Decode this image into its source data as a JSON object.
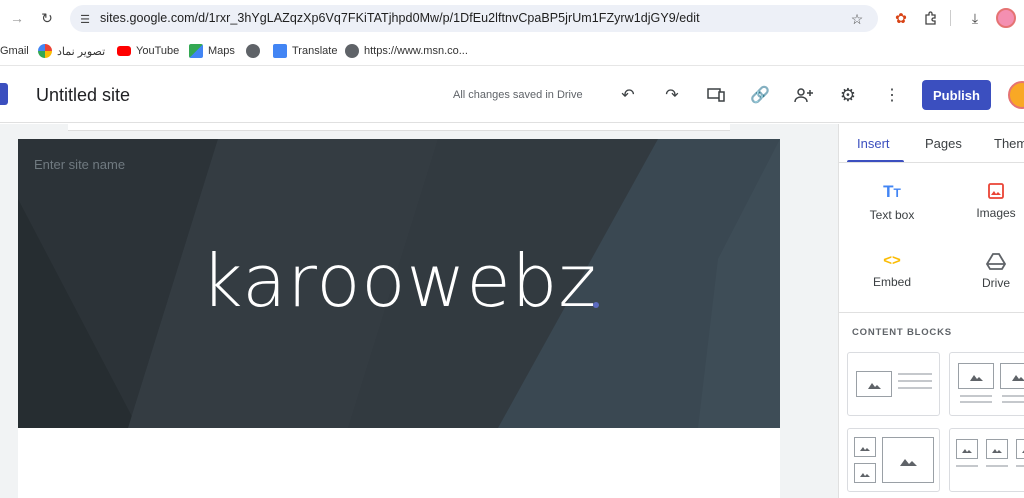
{
  "browser": {
    "url": "sites.google.com/d/1rxr_3hYgLAZqzXp6Vq7FKiTATjhpd0Mw/p/1DfEu2lftnvCpaBP5jrUm1FZyrw1djGY9/edit"
  },
  "bookmarks": [
    {
      "label": "Gmail",
      "icon": "gmail-icon",
      "color": "#ea4335"
    },
    {
      "label": "تصویر نماد",
      "icon": "photos-icon",
      "color": "#fbbc04"
    },
    {
      "label": "YouTube",
      "icon": "youtube-icon",
      "color": "#ff0000"
    },
    {
      "label": "Maps",
      "icon": "maps-icon",
      "color": "#34a853"
    },
    {
      "label": "",
      "icon": "globe-icon",
      "color": "#5f6368"
    },
    {
      "label": "Translate",
      "icon": "translate-icon",
      "color": "#4285f4"
    },
    {
      "label": "https://www.msn.co...",
      "icon": "globe-icon",
      "color": "#5f6368"
    }
  ],
  "header": {
    "title": "Untitled site",
    "save_status": "All changes saved in Drive",
    "publish_label": "Publish"
  },
  "banner": {
    "site_name_placeholder": "Enter site name",
    "hero_title": "karoowebz"
  },
  "panel": {
    "tabs": [
      "Insert",
      "Pages",
      "Them"
    ],
    "items": [
      {
        "label": "Text box",
        "icon": "text-box-icon",
        "color": "#4285f4"
      },
      {
        "label": "Images",
        "icon": "image-icon",
        "color": "#ea4335"
      },
      {
        "label": "Embed",
        "icon": "embed-icon",
        "color": "#fbbc04"
      },
      {
        "label": "Drive",
        "icon": "drive-icon",
        "color": "#5f6368"
      }
    ],
    "content_blocks_label": "CONTENT BLOCKS"
  },
  "colors": {
    "accent": "#3b4fbf",
    "banner": "#323a40"
  }
}
